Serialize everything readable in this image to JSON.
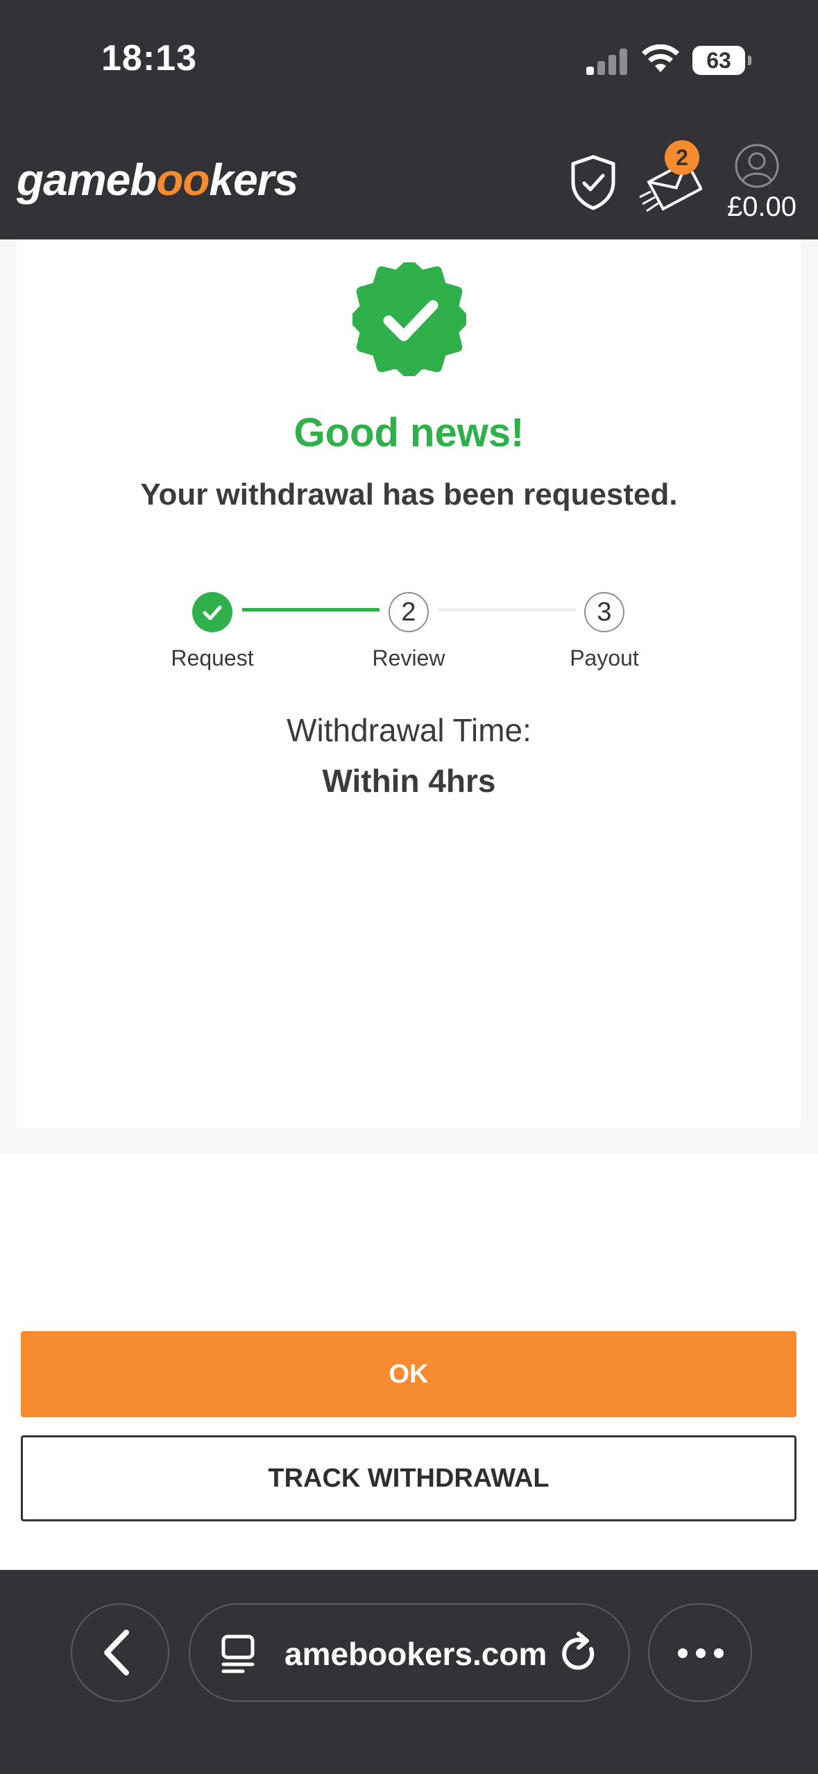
{
  "status_bar": {
    "time": "18:13",
    "battery": "63"
  },
  "header": {
    "logo_text_1": "gameb",
    "logo_text_oo": "oo",
    "logo_text_2": "kers",
    "notifications_count": "2",
    "balance": "£0.00",
    "accent_color": "#f68c2f"
  },
  "confirmation": {
    "headline": "Good news!",
    "subheadline": "Your withdrawal has been requested.",
    "success_color": "#2fb04a"
  },
  "stepper": {
    "steps": [
      {
        "number": "",
        "label": "Request",
        "state": "done"
      },
      {
        "number": "2",
        "label": "Review",
        "state": "pending"
      },
      {
        "number": "3",
        "label": "Payout",
        "state": "pending"
      }
    ]
  },
  "withdrawal_time": {
    "label": "Withdrawal Time:",
    "value": "Within 4hrs"
  },
  "actions": {
    "ok_label": "OK",
    "track_label": "TRACK WITHDRAWAL"
  },
  "browser": {
    "url": "amebookers.com"
  },
  "icons": [
    "shield-check-icon",
    "mail-icon",
    "user-icon",
    "success-check-icon",
    "back-chevron-icon",
    "tabs-icon",
    "reload-icon",
    "more-icon"
  ]
}
